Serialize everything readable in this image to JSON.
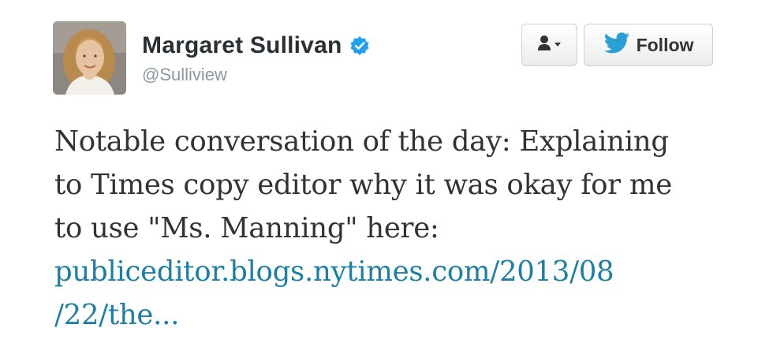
{
  "author": {
    "name": "Margaret Sullivan",
    "handle": "@Sulliview",
    "verified": true,
    "avatar": "profile-photo"
  },
  "actions": {
    "user_menu_icon": "user-dropdown-icon",
    "follow_icon": "twitter-bird-icon",
    "follow_label": "Follow"
  },
  "tweet": {
    "text_lines": [
      "Notable conversation of the day: Explaining",
      "to Times copy editor why it was okay for me",
      "to use \"Ms. Manning\" here:"
    ],
    "link_lines": [
      "publiceditor.blogs.nytimes.com/2013/08",
      "/22/the..."
    ]
  },
  "colors": {
    "name": "#292f33",
    "handle": "#8899a6",
    "body_text": "#333333",
    "link": "#1b7fa6",
    "verified_badge": "#1da1f2",
    "twitter_bird": "#2a9fd6"
  }
}
